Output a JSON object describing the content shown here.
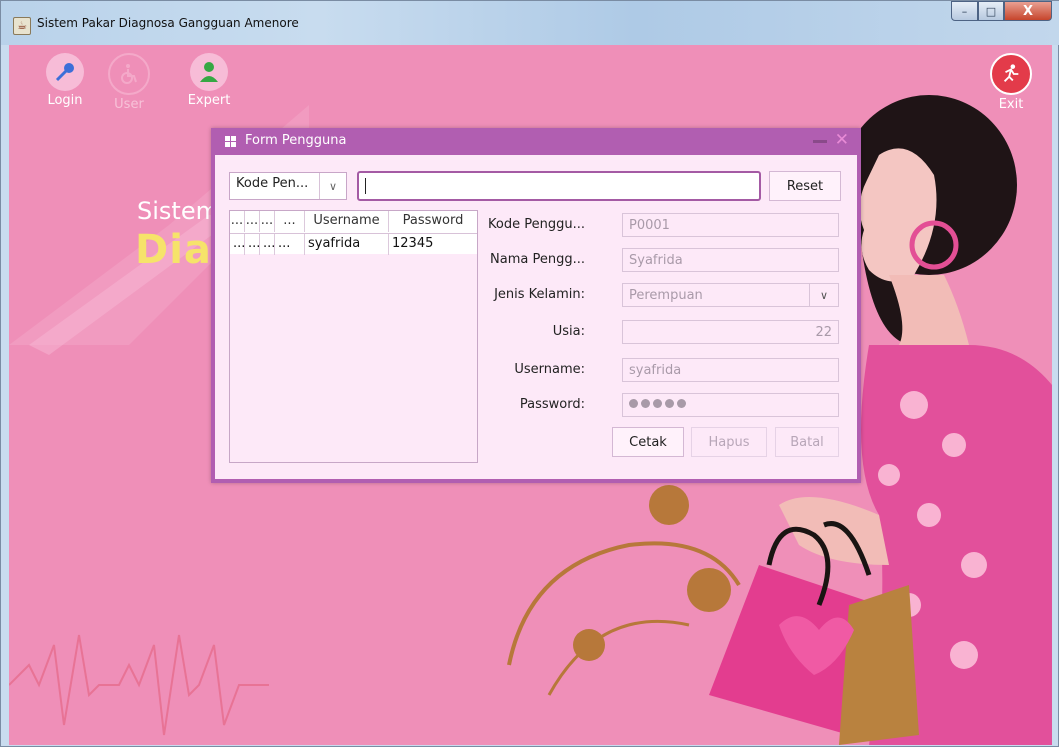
{
  "window": {
    "title": "Sistem Pakar Diagnosa Gangguan Amenore",
    "buttons": {
      "minimize": "–",
      "maximize": "□",
      "close": "X"
    }
  },
  "toolbar": {
    "login_label": "Login",
    "user_label": "User",
    "expert_label": "Expert",
    "exit_label": "Exit"
  },
  "splash": {
    "line1": "Sistem",
    "line2": "Dia"
  },
  "dialog": {
    "title": "Form Pengguna",
    "search": {
      "field_selected": "Kode Pen...",
      "value": ""
    },
    "reset_label": "Reset",
    "table": {
      "columns": [
        "...",
        "...",
        "...",
        "...",
        "Username",
        "Password"
      ],
      "rows": [
        {
          "c1": "...",
          "c2": "...",
          "c3": "...",
          "c4": "...",
          "username": "syafrida",
          "password": "12345"
        }
      ]
    },
    "form": {
      "kode_label": "Kode Penggu...",
      "kode_value": "P0001",
      "nama_label": "Nama Pengg...",
      "nama_value": "Syafrida",
      "jk_label": "Jenis Kelamin:",
      "jk_value": "Perempuan",
      "usia_label": "Usia:",
      "usia_value": "22",
      "username_label": "Username:",
      "username_value": "syafrida",
      "password_label": "Password:",
      "password_length": 5
    },
    "buttons": {
      "cetak": "Cetak",
      "hapus": "Hapus",
      "batal": "Batal"
    }
  },
  "colors": {
    "background": "#ef8fb8",
    "dialog_frame": "#b15eb1",
    "dialog_body": "#fde9f8",
    "accent_text": "#f6e36a"
  },
  "icons": [
    "login-key-icon",
    "user-wheelchair-icon",
    "expert-person-icon",
    "exit-runner-icon",
    "windows-logo-icon",
    "dropdown-chevron-icon"
  ]
}
